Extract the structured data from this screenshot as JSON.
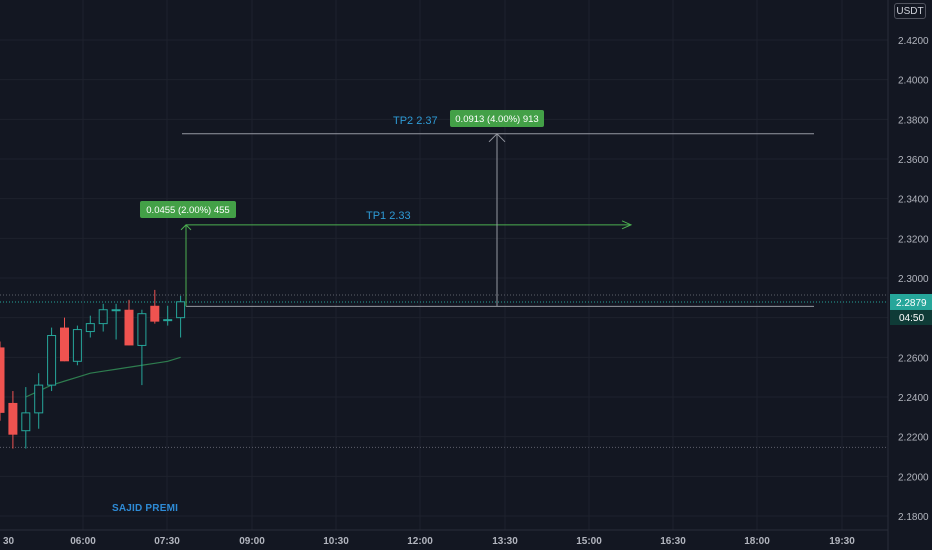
{
  "header": {
    "currency": "USDT"
  },
  "watermark": "SAJID PREMI",
  "price_axis": {
    "labels": [
      "2.4200",
      "2.4000",
      "2.3800",
      "2.3600",
      "2.3400",
      "2.3200",
      "2.3000",
      "2.2800",
      "2.2600",
      "2.2400",
      "2.2200",
      "2.2000",
      "2.1800"
    ],
    "current_price": "2.2879",
    "countdown": "04:50"
  },
  "time_axis": {
    "labels": [
      "30",
      "06:00",
      "07:30",
      "09:00",
      "10:30",
      "12:00",
      "13:30",
      "15:00",
      "16:30",
      "18:00",
      "19:30"
    ]
  },
  "annotations": {
    "tp1": {
      "label": "TP1 2.33",
      "measure": "0.0455 (2.00%) 455"
    },
    "tp2": {
      "label": "TP2  2.37",
      "measure": "0.0913 (4.00%) 913"
    }
  },
  "colors": {
    "background": "#131722",
    "up": "#26a69a",
    "down": "#ef5350",
    "measure_green": "#4caf50",
    "label_blue": "#2e9bd6",
    "grid": "#1e222d",
    "text": "#b2b5be"
  },
  "chart_data": {
    "type": "candlestick",
    "y_range": [
      2.17,
      2.435
    ],
    "candles": [
      {
        "o": 2.265,
        "h": 2.268,
        "l": 2.228,
        "c": 2.232
      },
      {
        "o": 2.237,
        "h": 2.243,
        "l": 2.214,
        "c": 2.221
      },
      {
        "o": 2.223,
        "h": 2.245,
        "l": 2.214,
        "c": 2.232
      },
      {
        "o": 2.232,
        "h": 2.252,
        "l": 2.224,
        "c": 2.246
      },
      {
        "o": 2.246,
        "h": 2.275,
        "l": 2.243,
        "c": 2.271
      },
      {
        "o": 2.275,
        "h": 2.28,
        "l": 2.258,
        "c": 2.258
      },
      {
        "o": 2.258,
        "h": 2.276,
        "l": 2.256,
        "c": 2.274
      },
      {
        "o": 2.273,
        "h": 2.281,
        "l": 2.27,
        "c": 2.277
      },
      {
        "o": 2.277,
        "h": 2.287,
        "l": 2.273,
        "c": 2.284
      },
      {
        "o": 2.284,
        "h": 2.287,
        "l": 2.269,
        "c": 2.284
      },
      {
        "o": 2.284,
        "h": 2.289,
        "l": 2.266,
        "c": 2.266
      },
      {
        "o": 2.266,
        "h": 2.284,
        "l": 2.246,
        "c": 2.282
      },
      {
        "o": 2.286,
        "h": 2.294,
        "l": 2.277,
        "c": 2.278
      },
      {
        "o": 2.279,
        "h": 2.286,
        "l": 2.276,
        "c": 2.279
      },
      {
        "o": 2.28,
        "h": 2.291,
        "l": 2.27,
        "c": 2.288
      }
    ],
    "ma": [
      2.24,
      2.243,
      2.246,
      2.248,
      2.25,
      2.252,
      2.253,
      2.254,
      2.255,
      2.256,
      2.257,
      2.258,
      2.26
    ],
    "tp1": 2.33,
    "tp2": 2.37,
    "entry": 2.2857,
    "session_high": 2.2914,
    "session_low": 2.2146
  }
}
